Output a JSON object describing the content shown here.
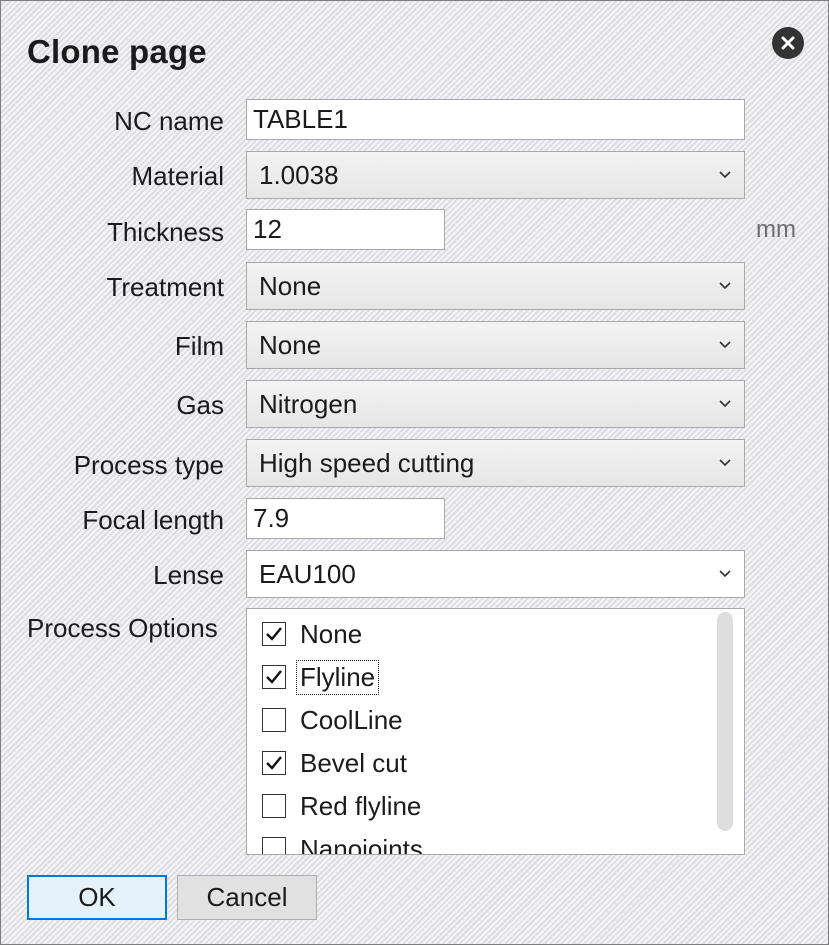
{
  "dialog": {
    "title": "Clone page",
    "close_icon": "close-icon"
  },
  "fields": {
    "nc_name": {
      "label": "NC name",
      "value": "TABLE1"
    },
    "material": {
      "label": "Material",
      "value": "1.0038"
    },
    "thickness": {
      "label": "Thickness",
      "value": "12",
      "unit": "mm"
    },
    "treatment": {
      "label": "Treatment",
      "value": "None"
    },
    "film": {
      "label": "Film",
      "value": "None"
    },
    "gas": {
      "label": "Gas",
      "value": "Nitrogen"
    },
    "process_type": {
      "label": "Process type",
      "value": "High speed cutting"
    },
    "focal_length": {
      "label": "Focal length",
      "value": "7.9"
    },
    "lense": {
      "label": "Lense",
      "value": "EAU100"
    }
  },
  "process_options": {
    "label": "Process Options",
    "items": [
      {
        "label": "None",
        "checked": true
      },
      {
        "label": "Flyline",
        "checked": true,
        "focused": true
      },
      {
        "label": "CoolLine",
        "checked": false
      },
      {
        "label": "Bevel cut",
        "checked": true
      },
      {
        "label": "Red flyline",
        "checked": false
      },
      {
        "label": "Nanojoints",
        "checked": false
      }
    ]
  },
  "buttons": {
    "ok": "OK",
    "cancel": "Cancel"
  },
  "colors": {
    "focus_border": "#0078d7",
    "close_bg": "#333333"
  }
}
